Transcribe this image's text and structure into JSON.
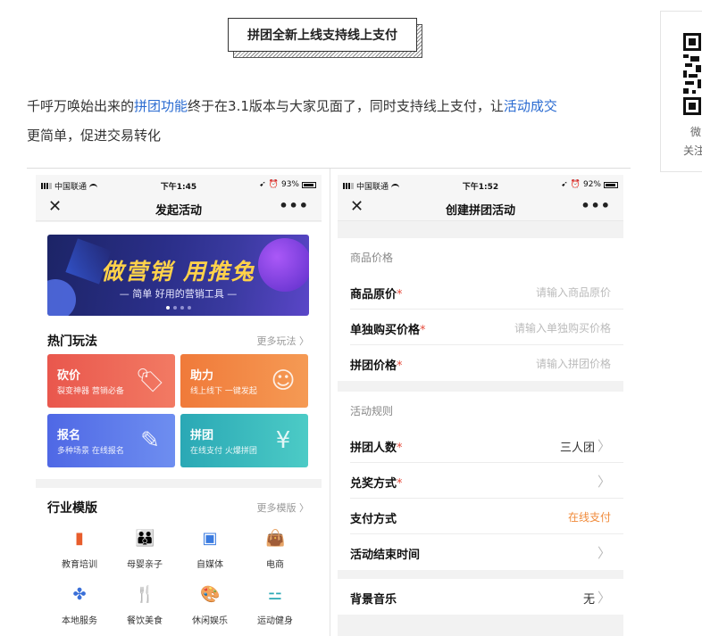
{
  "title": "拼团全新上线支持线上支付",
  "intro": {
    "part1": "千呼万唤始出来的",
    "link1": "拼团功能",
    "part2": "终于在3.1版本与大家见面了，同时支持线上支付，让",
    "link2": "活动成交",
    "part3": "更简单，促进交易转化"
  },
  "sidebar": {
    "caption_line1": "微",
    "caption_line2": "关注"
  },
  "left_phone": {
    "status": {
      "carrier": "中国联通",
      "time": "下午1:45",
      "battery": "93%"
    },
    "nav_title": "发起活动",
    "banner": {
      "headline": "做营销 用推兔",
      "subline": "— 简单 好用的营销工具 —"
    },
    "hot": {
      "heading": "热门玩法",
      "more": "更多玩法",
      "cards": [
        {
          "title": "砍价",
          "sub": "裂变神器 营销必备"
        },
        {
          "title": "助力",
          "sub": "线上线下 一键发起"
        },
        {
          "title": "报名",
          "sub": "多种场景 在线报名"
        },
        {
          "title": "拼团",
          "sub": "在线支付 火爆拼团"
        }
      ]
    },
    "industry": {
      "heading": "行业模版",
      "more": "更多模版",
      "items": [
        "教育培训",
        "母婴亲子",
        "自媒体",
        "电商",
        "本地服务",
        "餐饮美食",
        "休闲娱乐",
        "运动健身"
      ]
    }
  },
  "right_phone": {
    "status": {
      "carrier": "中国联通",
      "time": "下午1:52",
      "battery": "92%"
    },
    "nav_title": "创建拼团活动",
    "price_group": "商品价格",
    "rows_price": [
      {
        "label": "商品原价",
        "required": "*",
        "placeholder": "请输入商品原价"
      },
      {
        "label": "单独购买价格",
        "required": "*",
        "placeholder": "请输入单独购买价格"
      },
      {
        "label": "拼团价格",
        "required": "*",
        "placeholder": "请输入拼团价格"
      }
    ],
    "rule_group": "活动规则",
    "rows_rule": [
      {
        "label": "拼团人数",
        "required": "*",
        "value": "三人团"
      },
      {
        "label": "兑奖方式",
        "required": "*",
        "value": ""
      },
      {
        "label": "支付方式",
        "required": "",
        "value": "在线支付"
      },
      {
        "label": "活动结束时间",
        "required": "",
        "value": ""
      }
    ],
    "music": {
      "label": "背景音乐",
      "value": "无"
    }
  },
  "colors": {
    "link": "#2a6bd1",
    "required": "#e54b3c",
    "online_pay": "#f08a3a"
  }
}
